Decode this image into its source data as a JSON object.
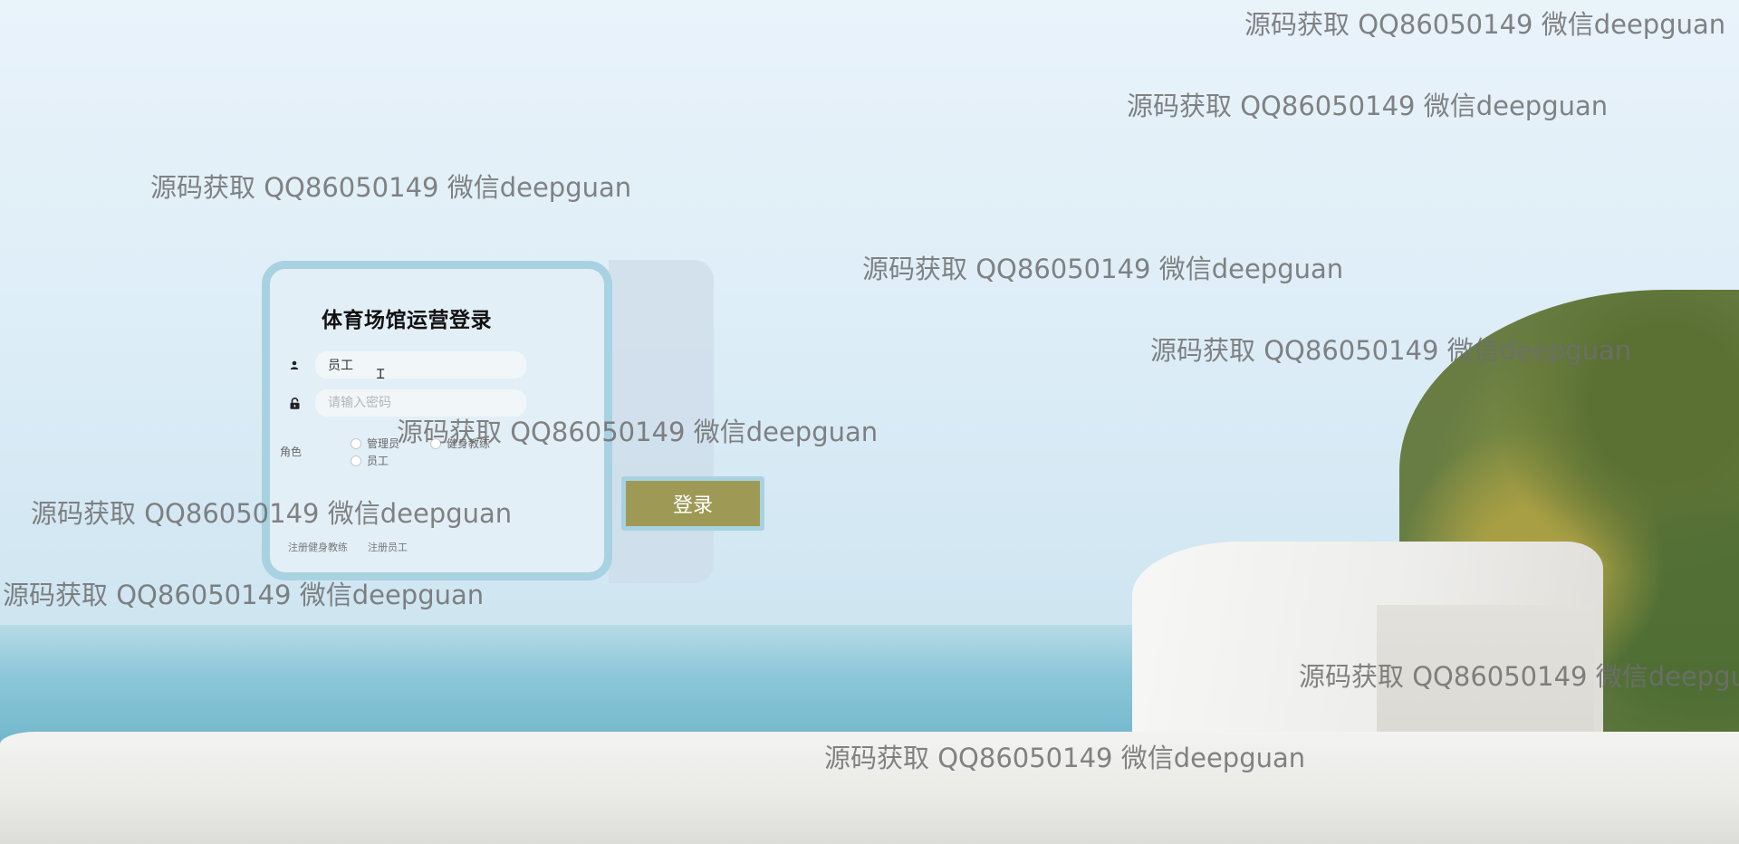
{
  "login": {
    "title": "体育场馆运营登录",
    "username_value": "员工",
    "password_placeholder": "请输入密码",
    "role_label": "角色",
    "role_options": [
      "管理员",
      "健身教练",
      "员工"
    ],
    "submit_label": "登录",
    "links": [
      "注册健身教练",
      "注册员工"
    ]
  },
  "watermark": {
    "text": "源码获取 QQ86050149 微信deepguan"
  },
  "colors": {
    "card_border": "#a8d2e1",
    "card_bg": "#e3eff6",
    "button_bg": "#9e9a56"
  },
  "icons": {
    "user": "user-icon",
    "lock": "lock-icon"
  }
}
